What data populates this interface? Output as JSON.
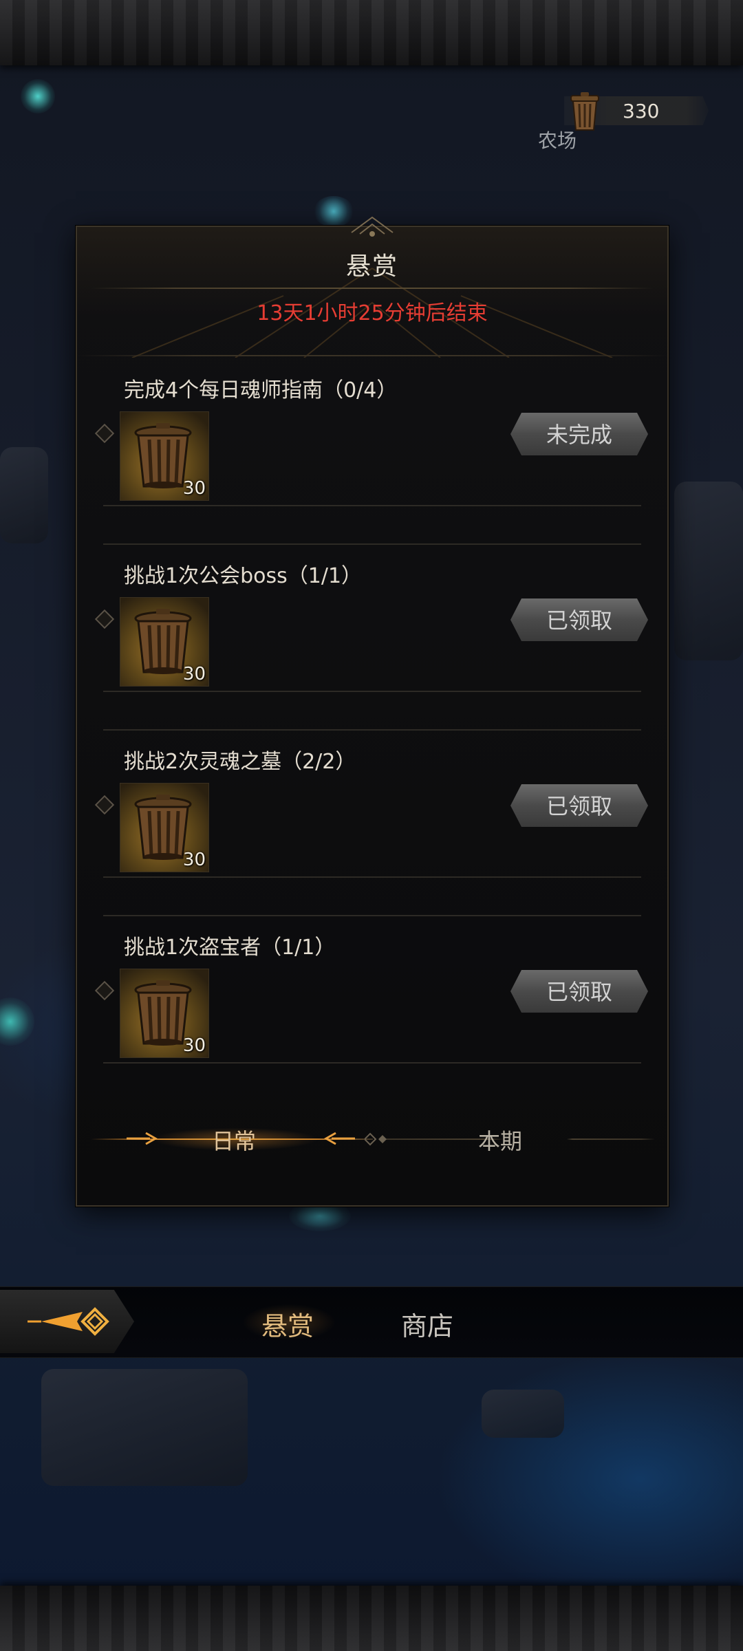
{
  "currency": {
    "icon": "trash-can-icon",
    "value": "330",
    "area_label": "农场"
  },
  "panel": {
    "title": "悬赏",
    "countdown": "13天1小时25分钟后结束"
  },
  "quests": [
    {
      "title": "完成4个每日魂师指南（0/4）",
      "reward_icon": "trash-can-icon",
      "reward_count": "30",
      "status": "未完成"
    },
    {
      "title": "挑战1次公会boss（1/1）",
      "reward_icon": "trash-can-icon",
      "reward_count": "30",
      "status": "已领取"
    },
    {
      "title": "挑战2次灵魂之墓（2/2）",
      "reward_icon": "trash-can-icon",
      "reward_count": "30",
      "status": "已领取"
    },
    {
      "title": "挑战1次盗宝者（1/1）",
      "reward_icon": "trash-can-icon",
      "reward_count": "30",
      "status": "已领取"
    }
  ],
  "tabs": {
    "daily": "日常",
    "period": "本期",
    "active": "daily"
  },
  "bottom_nav": {
    "bounty": "悬赏",
    "shop": "商店",
    "active": "bounty"
  },
  "colors": {
    "accent": "#e0a040",
    "countdown": "#e63d33",
    "status_button": "#555555"
  }
}
